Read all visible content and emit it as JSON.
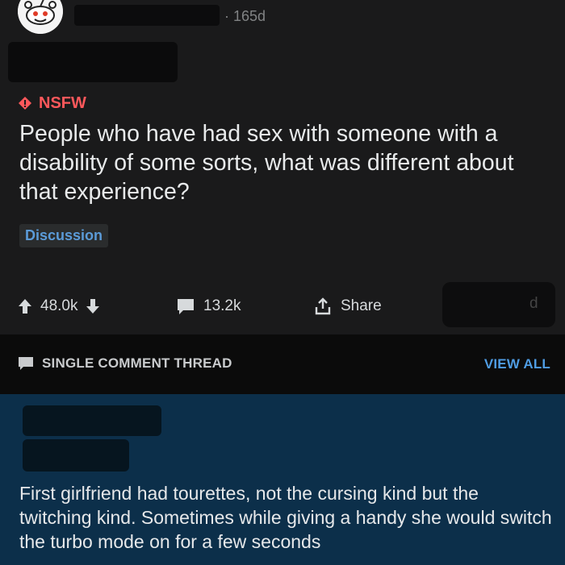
{
  "post": {
    "age": "165d",
    "nsfw_label": "NSFW",
    "title": "People who have had sex with someone with a disability of some sorts, what was different about that experience?",
    "flair": "Discussion",
    "upvotes": "48.0k",
    "comments": "13.2k",
    "share_label": "Share",
    "award_suffix": "d"
  },
  "thread": {
    "label": "SINGLE COMMENT THREAD",
    "view_all": "VIEW ALL"
  },
  "comment": {
    "body": "First girlfriend had tourettes, not the cursing kind but the twitching kind. Sometimes while giving a handy she would switch the turbo mode on for a few seconds"
  },
  "colors": {
    "background": "#1a1a1b",
    "nsfw": "#ff585b",
    "flair_text": "#5b9bd8",
    "view_all": "#4f9ce3",
    "comment_highlight": "#0c2f4a"
  },
  "icons": [
    "reddit-avatar-icon",
    "nsfw-diamond-icon",
    "upvote-icon",
    "downvote-icon",
    "comment-icon",
    "share-icon",
    "thread-comment-icon"
  ]
}
